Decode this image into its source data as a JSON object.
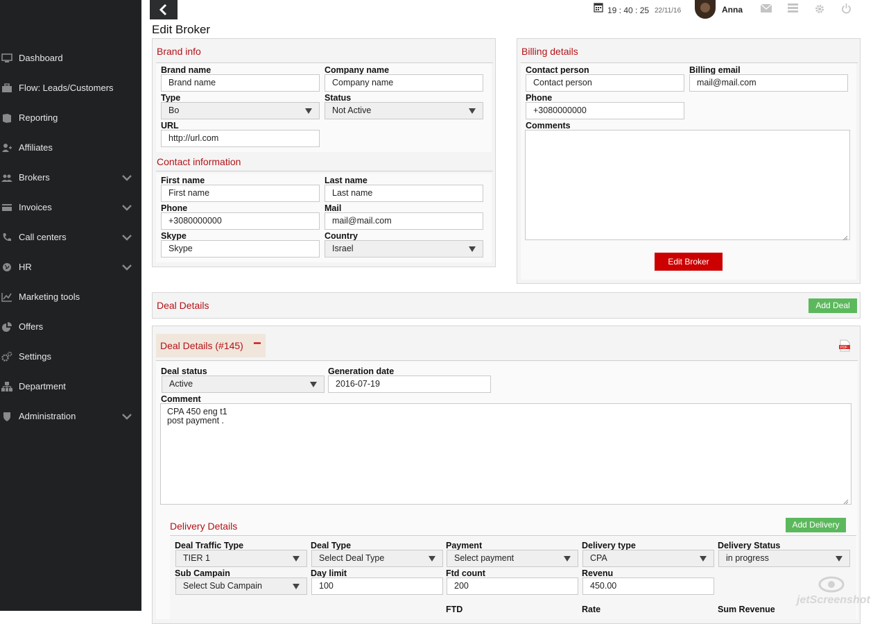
{
  "sidebar": {
    "items": [
      {
        "label": "Dashboard",
        "icon": "monitor-icon",
        "has_chevron": false
      },
      {
        "label": "Flow: Leads/Customers",
        "icon": "briefcase-icon",
        "has_chevron": false
      },
      {
        "label": "Reporting",
        "icon": "book-icon",
        "has_chevron": false
      },
      {
        "label": "Affiliates",
        "icon": "user-plus-icon",
        "has_chevron": false
      },
      {
        "label": "Brokers",
        "icon": "users-icon",
        "has_chevron": true
      },
      {
        "label": "Invoices",
        "icon": "credit-card-icon",
        "has_chevron": true
      },
      {
        "label": "Call centers",
        "icon": "phone-icon",
        "has_chevron": true
      },
      {
        "label": "HR",
        "icon": "globe-icon",
        "has_chevron": true
      },
      {
        "label": "Marketing tools",
        "icon": "line-chart-icon",
        "has_chevron": false
      },
      {
        "label": "Offers",
        "icon": "pie-chart-icon",
        "has_chevron": false
      },
      {
        "label": "Settings",
        "icon": "gears-icon",
        "has_chevron": false
      },
      {
        "label": "Department",
        "icon": "sitemap-icon",
        "has_chevron": false
      },
      {
        "label": "Administration",
        "icon": "shield-icon",
        "has_chevron": true
      }
    ]
  },
  "topbar": {
    "time": "19 : 40 : 25",
    "date": "22/11/16",
    "user_name": "Anna",
    "icons": [
      "calendar-icon",
      "envelope-icon",
      "list-icon",
      "gear-icon",
      "power-icon"
    ]
  },
  "page": {
    "title": "Edit Broker"
  },
  "brand_info": {
    "title": "Brand info",
    "brand_name": {
      "label": "Brand name",
      "value": "Brand name"
    },
    "company_name": {
      "label": "Company name",
      "value": "Company name"
    },
    "type": {
      "label": "Type",
      "value": "Bo"
    },
    "status": {
      "label": "Status",
      "value": "Not Active"
    },
    "url": {
      "label": "URL",
      "value": "http://url.com"
    }
  },
  "contact_info": {
    "title": "Contact information",
    "first_name": {
      "label": "First name",
      "value": "First name"
    },
    "last_name": {
      "label": "Last name",
      "value": "Last name"
    },
    "phone": {
      "label": "Phone",
      "value": "+3080000000"
    },
    "mail": {
      "label": "Mail",
      "value": "mail@mail.com"
    },
    "skype": {
      "label": "Skype",
      "value": "Skype"
    },
    "country": {
      "label": "Country",
      "value": "Israel"
    }
  },
  "billing": {
    "title": "Billing details",
    "contact_person": {
      "label": "Contact person",
      "value": "Contact person"
    },
    "billing_email": {
      "label": "Billing email",
      "value": "mail@mail.com"
    },
    "phone": {
      "label": "Phone",
      "value": "+3080000000"
    },
    "comments": {
      "label": "Comments",
      "value": ""
    },
    "edit_button": "Edit Broker"
  },
  "deal_details": {
    "title": "Deal Details",
    "add_button": "Add Deal",
    "deal": {
      "title": "Deal Details (#145)",
      "collapse_symbol": "−",
      "deal_status": {
        "label": "Deal status",
        "value": "Active"
      },
      "generation_date": {
        "label": "Generation date",
        "value": "2016-07-19"
      },
      "comment": {
        "label": "Comment",
        "value": "CPA 450 eng t1\npost payment ."
      }
    }
  },
  "delivery": {
    "title": "Delivery Details",
    "add_button": "Add Delivery",
    "deal_traffic_type": {
      "label": "Deal Traffic Type",
      "value": "TIER 1"
    },
    "deal_type": {
      "label": "Deal Type",
      "value": "Select Deal Type"
    },
    "payment": {
      "label": "Payment",
      "value": "Select payment"
    },
    "delivery_type": {
      "label": "Delivery type",
      "value": "CPA"
    },
    "delivery_status": {
      "label": "Delivery Status",
      "value": "in progress"
    },
    "sub_campain": {
      "label": "Sub Campain",
      "value": "Select Sub Campain"
    },
    "day_limit": {
      "label": "Day limit",
      "value": "100"
    },
    "ftd_count": {
      "label": "Ftd count",
      "value": "200"
    },
    "revenu": {
      "label": "Revenu",
      "value": "450.00"
    },
    "footer_labels": [
      "FTD",
      "Rate",
      "Sum Revenue"
    ]
  },
  "watermark": "jetScreenshot"
}
